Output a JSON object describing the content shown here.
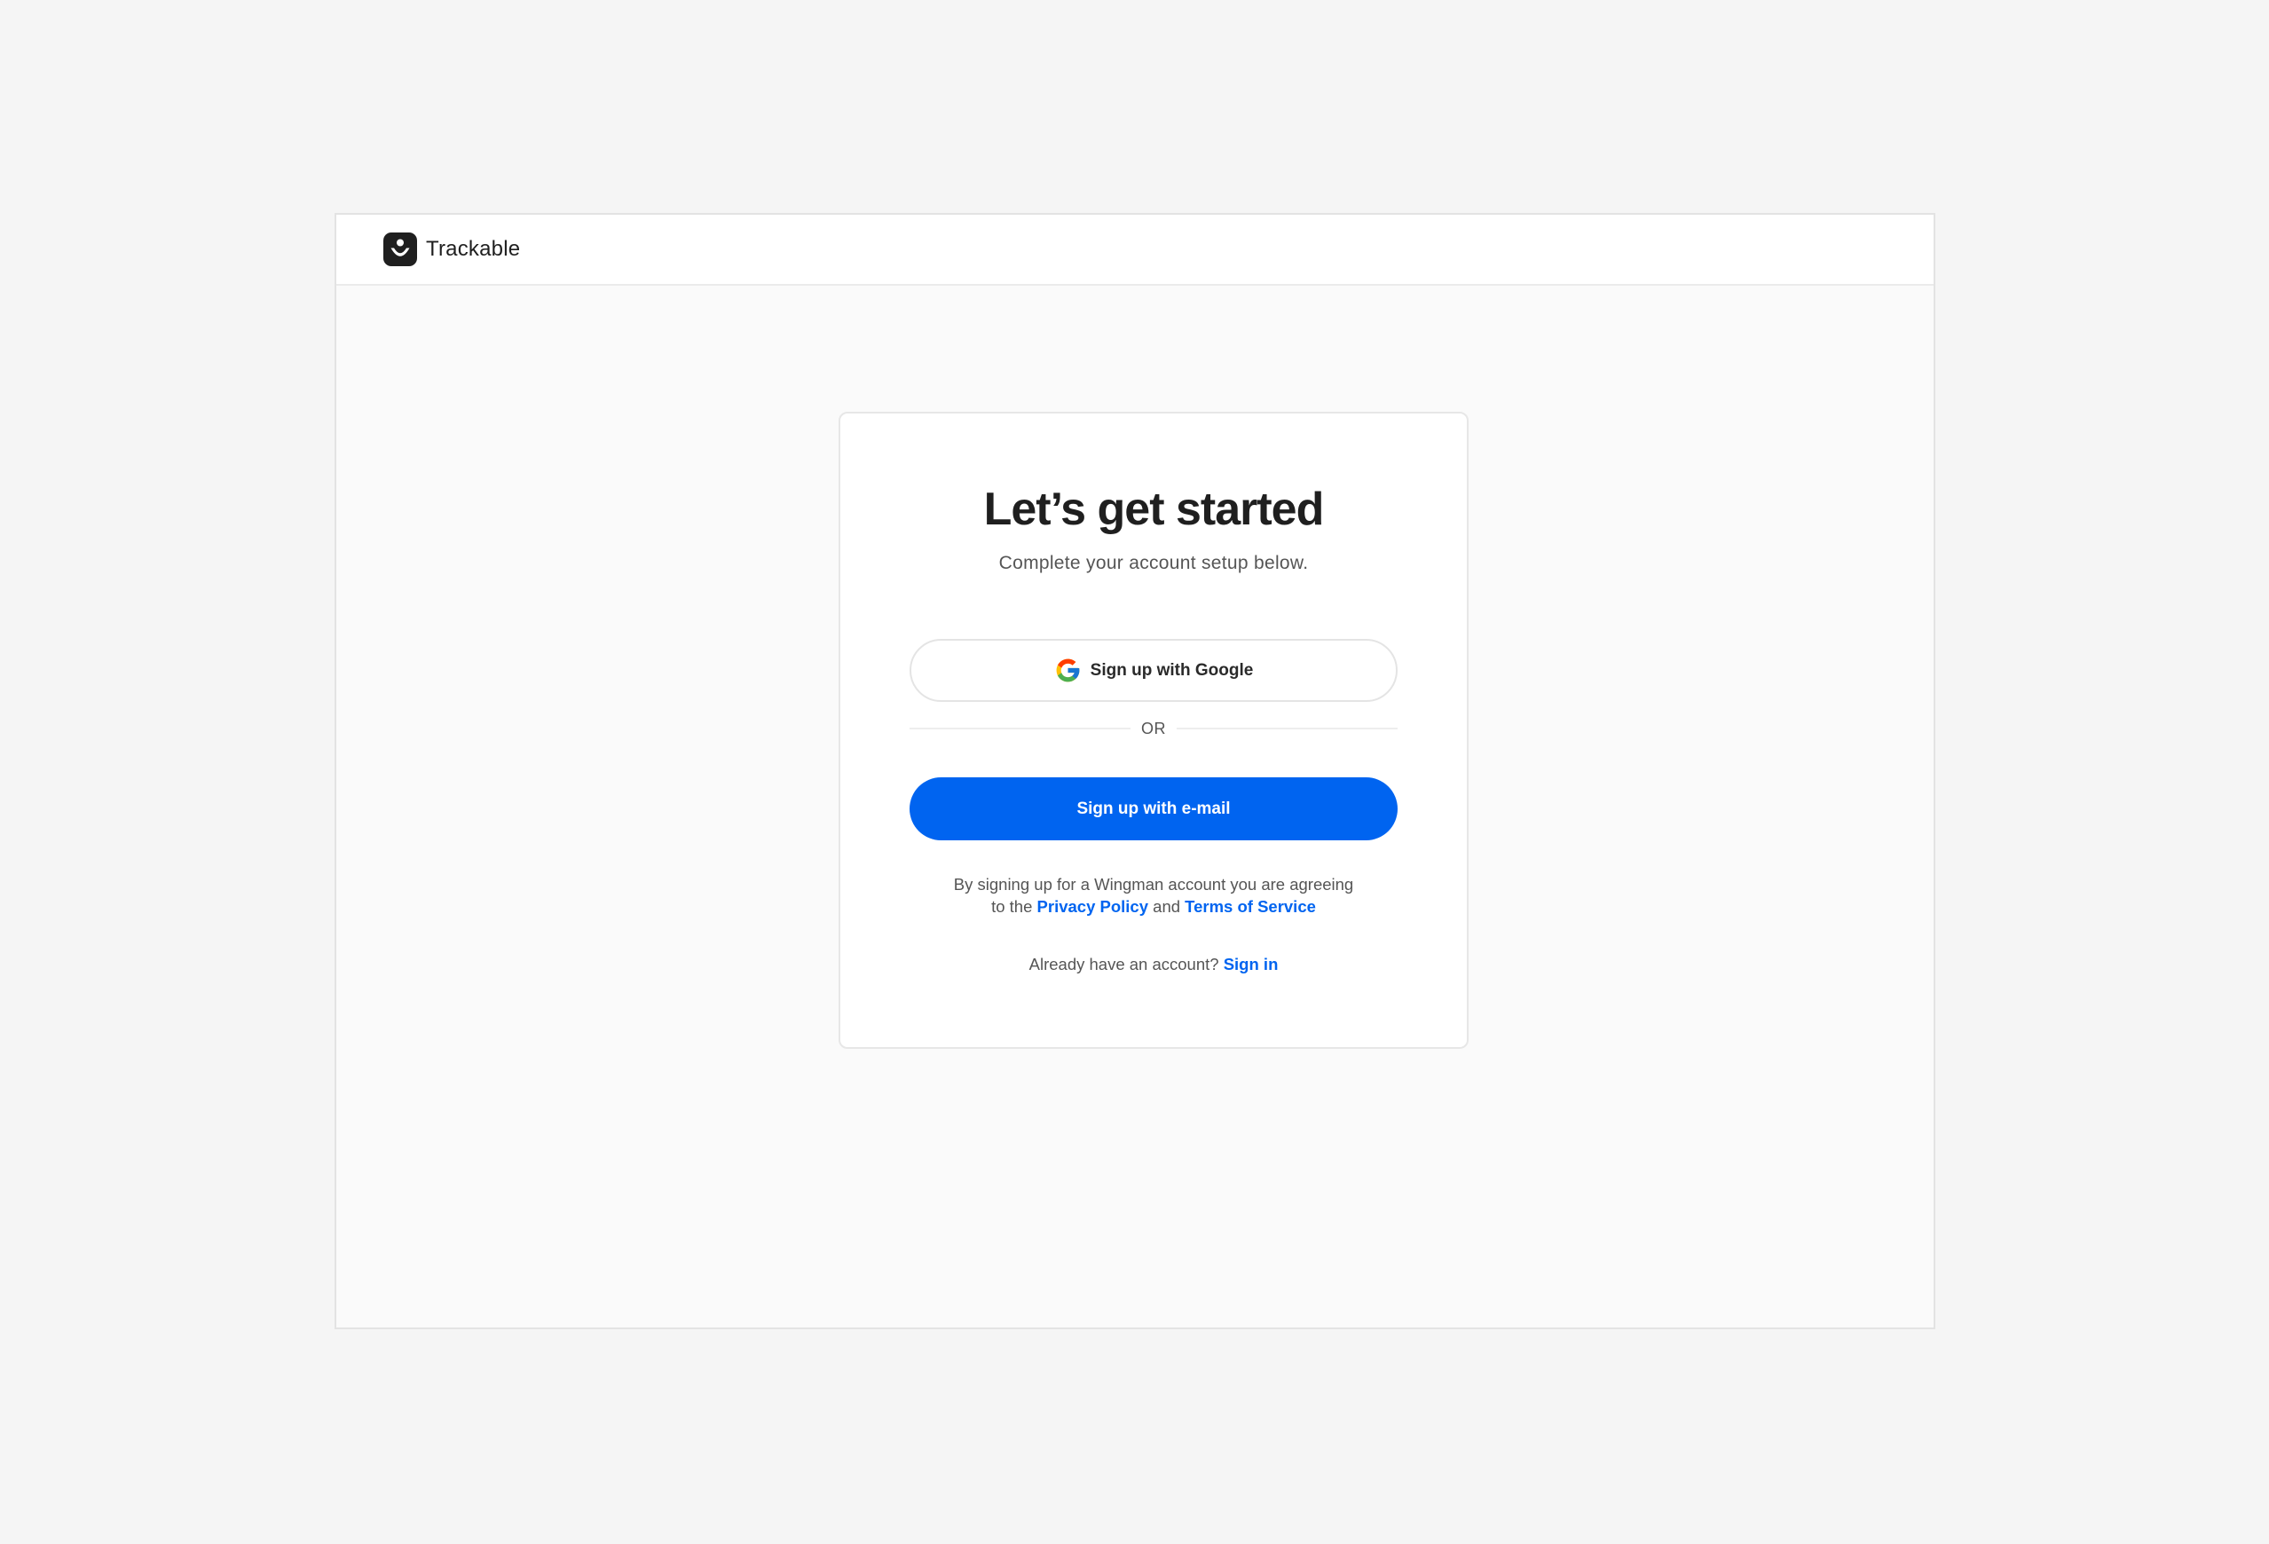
{
  "brand": {
    "name": "Trackable",
    "logo_icon": "trackable-logo-icon",
    "logo_color": "#1f1f1f"
  },
  "card": {
    "title": "Let’s get started",
    "subtitle": "Complete your account setup below."
  },
  "google_button": {
    "label": "Sign up with Google",
    "icon": "google-icon"
  },
  "divider": {
    "text": "OR"
  },
  "email_button": {
    "label": "Sign up with e-mail",
    "color": "#0064f0"
  },
  "legal": {
    "line1": "By signing up for a Wingman account you are agreeing",
    "to_the": "to the",
    "privacy_link": "Privacy Policy",
    "and": "and",
    "terms_link": "Terms of Service"
  },
  "signin": {
    "prompt": "Already have an account?",
    "link": "Sign in"
  },
  "colors": {
    "accent": "#0064f0",
    "page_background": "#f5f5f5",
    "frame_background": "#fafafa"
  }
}
